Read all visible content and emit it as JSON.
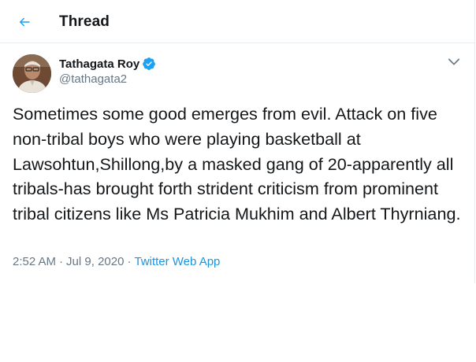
{
  "header": {
    "back_icon": "arrow-left-icon",
    "title": "Thread"
  },
  "tweet": {
    "author": {
      "display_name": "Tathagata Roy",
      "handle": "@tathagata2",
      "verified": true
    },
    "more_icon": "chevron-down-icon",
    "text": "Sometimes some good emerges from evil. Attack on five non-tribal boys who were playing basketball at Lawsohtun,Shillong,by a masked gang of 20-apparently all tribals-has brought forth strident criticism from prominent tribal citizens like Ms Patricia Mukhim and Albert Thyrniang.",
    "time": "2:52 AM",
    "date": "Jul 9, 2020",
    "separator": "·",
    "source": "Twitter Web App"
  },
  "colors": {
    "accent": "#1da1f2",
    "link": "#1b95e0",
    "muted_text": "#657786",
    "primary_text": "#14171a",
    "border": "#e6ecf0"
  }
}
